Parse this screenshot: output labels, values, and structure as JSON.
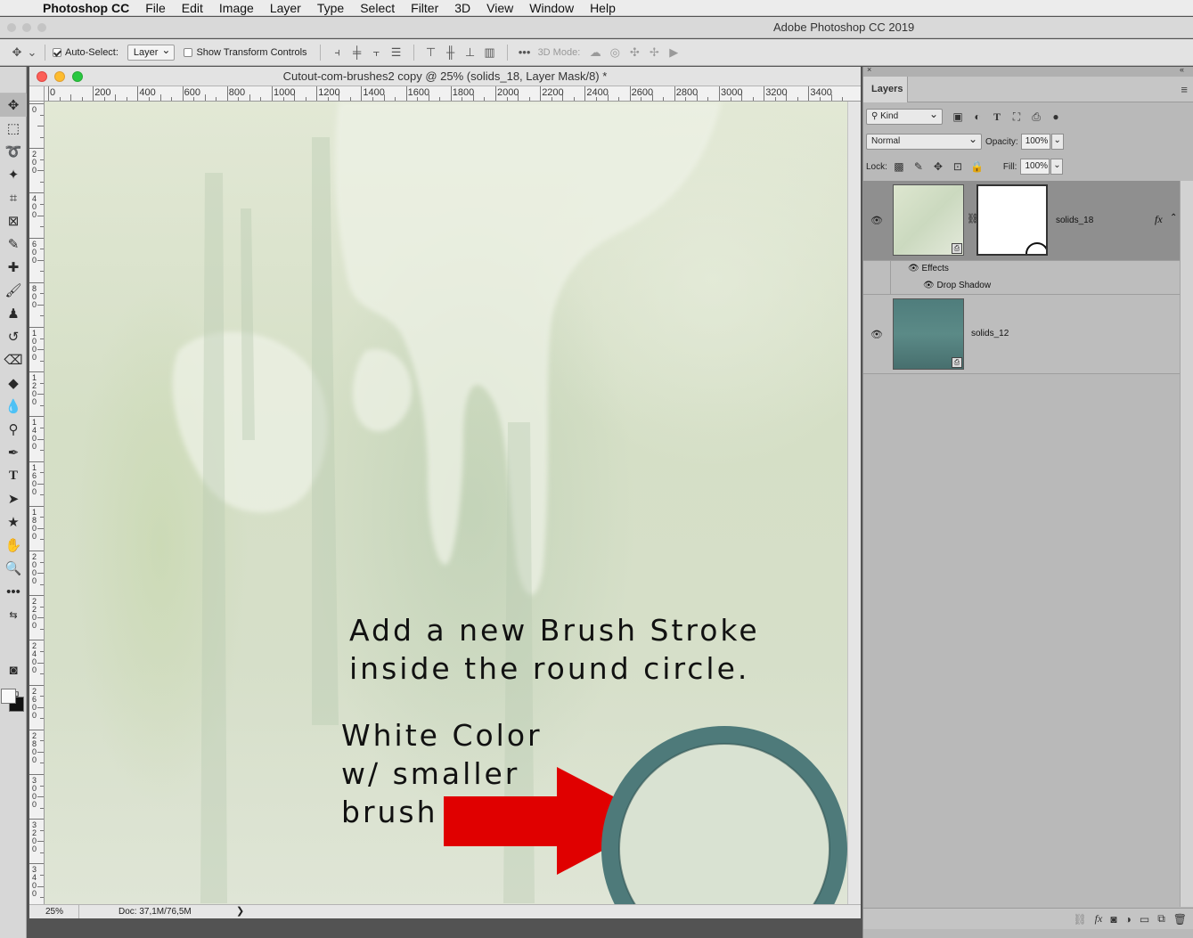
{
  "menubar": {
    "app_name": "Photoshop CC",
    "items": [
      "File",
      "Edit",
      "Image",
      "Layer",
      "Type",
      "Select",
      "Filter",
      "3D",
      "View",
      "Window",
      "Help"
    ]
  },
  "app_title": "Adobe Photoshop CC 2019",
  "options": {
    "auto_select_label": "Auto-Select:",
    "auto_select_value": "Layer",
    "show_transform_label": "Show Transform Controls",
    "more_label": "•••",
    "mode_3d_label": "3D Mode:"
  },
  "document": {
    "title": "Cutout-com-brushes2 copy @ 25% (solids_18, Layer Mask/8) *",
    "ruler_labels": [
      "0",
      "200",
      "400",
      "600",
      "800",
      "1000",
      "1200",
      "1400",
      "1600",
      "1800",
      "2000",
      "2200",
      "2400",
      "2600",
      "2800",
      "3000",
      "3200",
      "3400"
    ],
    "vruler_labels": [
      "0",
      "200",
      "400",
      "600",
      "800",
      "1000",
      "1200",
      "1400",
      "1600",
      "1800",
      "2000",
      "2200",
      "2400",
      "2600",
      "2800",
      "3000",
      "3200",
      "3400"
    ],
    "annotation_top": "Add a new Brush Stroke\ninside the round circle.",
    "annotation_bottom": "White Color\nw/ smaller\nbrush",
    "zoom": "25%",
    "doc_size": "Doc: 37,1M/76,5M",
    "status_arrow": "❯",
    "colors": {
      "arrow": "#e00000",
      "ring": "#4e7a7a"
    }
  },
  "layers_panel": {
    "tab": "Layers",
    "filter_kind": "Kind",
    "blend_mode": "Normal",
    "opacity_label": "Opacity:",
    "opacity_value": "100%",
    "lock_label": "Lock:",
    "fill_label": "Fill:",
    "fill_value": "100%",
    "layers": [
      {
        "name": "solids_18",
        "fx": "fx",
        "effects_label": "Effects",
        "effect": "Drop Shadow"
      },
      {
        "name": "solids_12"
      }
    ]
  }
}
